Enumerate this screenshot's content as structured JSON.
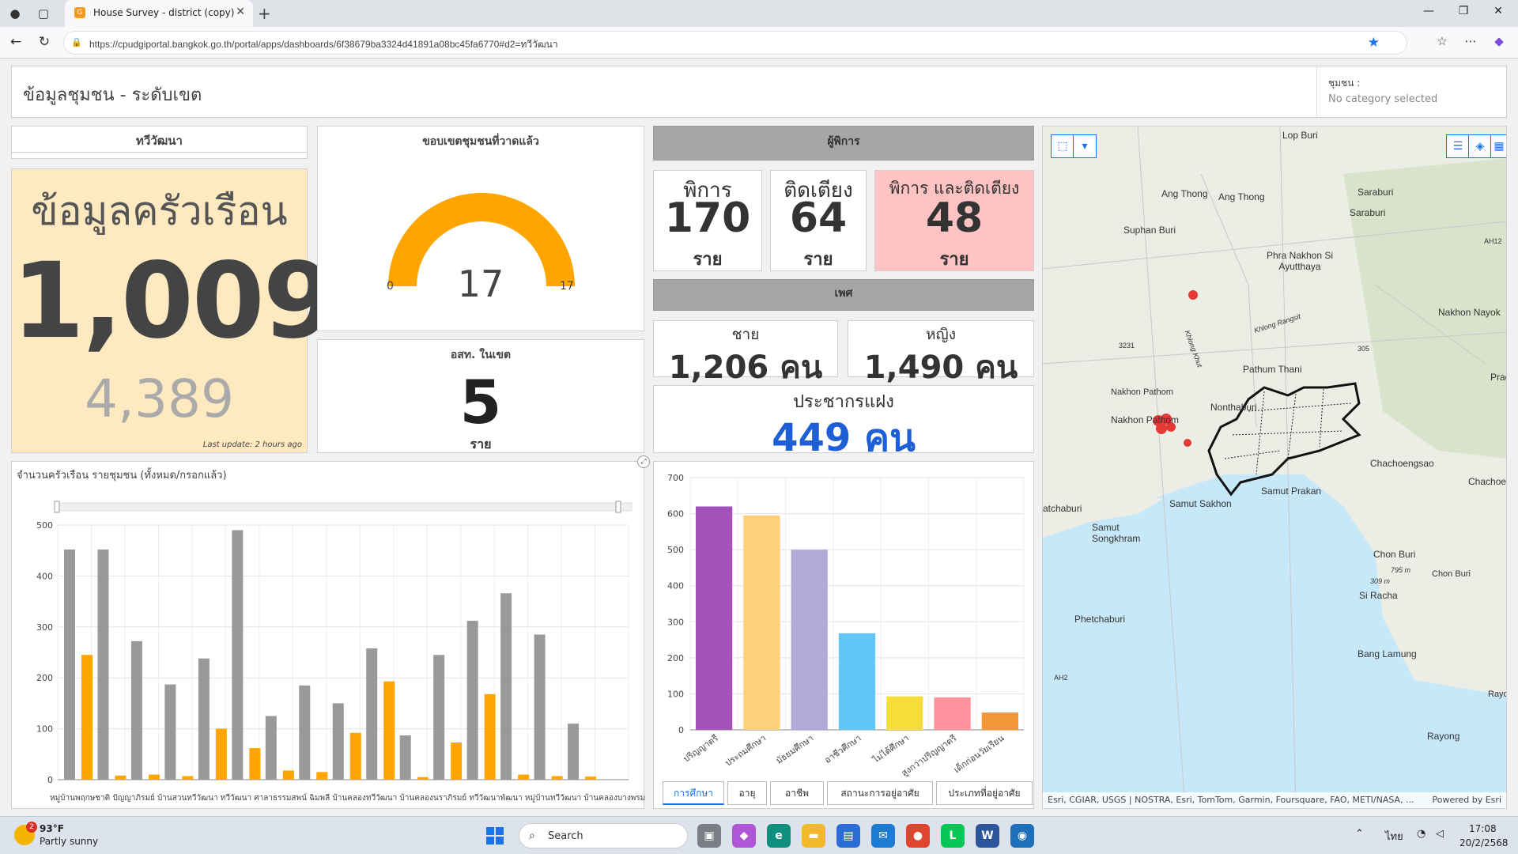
{
  "browser": {
    "tab_title": "House Survey - district (copy)",
    "url": "https://cpudgiportal.bangkok.go.th/portal/apps/dashboards/6f38679ba3324d41891a08bc45fa6770#d2=ทวีวัฒนา"
  },
  "header": {
    "title": "ข้อมูลชุมชน - ระดับเขต",
    "filter_label": "ชุมชน :",
    "filter_value": "No category selected"
  },
  "district": {
    "name": "ทวีวัฒนา"
  },
  "household": {
    "title": "ข้อมูลครัวเรือน",
    "value": "1,009",
    "sub_value": "4,389",
    "last_update": "Last update: 2 hours ago"
  },
  "gauge": {
    "title": "ขอบเขตชุมชนที่วาดแล้ว",
    "value": "17",
    "min": "0",
    "max": "17",
    "fill_fraction": 1.0,
    "color": "#ffa500"
  },
  "osm": {
    "title": "อสท. ในเขต",
    "value": "5",
    "unit": "ราย"
  },
  "disability": {
    "header": "ผู้พิการ",
    "cards": [
      {
        "label": "พิการ",
        "value": "170",
        "unit": "ราย"
      },
      {
        "label": "ติดเตียง",
        "value": "64",
        "unit": "ราย"
      },
      {
        "label": "พิการ และติดเตียง",
        "value": "48",
        "unit": "ราย"
      }
    ]
  },
  "gender": {
    "header": "เพศ",
    "male_label": "ชาย",
    "male_value": "1,206 คน",
    "female_label": "หญิง",
    "female_value": "1,490 คน"
  },
  "hidden_pop": {
    "label": "ประชากรแฝง",
    "value": "449 คน"
  },
  "colors": {
    "header_gray": "#a6a6a6",
    "household_bg": "#ffe9c0",
    "pink_card": "#ffc3c3",
    "accent_blue": "#1e5fd6",
    "bar_gray": "#999999",
    "bar_orange": "#ffa500"
  },
  "chart_data": [
    {
      "type": "bar",
      "title": "จำนวนครัวเรือน รายชุมชน (ทั้งหมด/กรอกแล้ว)",
      "categories": [
        "",
        "",
        "",
        "",
        "",
        "",
        "",
        "",
        "",
        "",
        "",
        "",
        "",
        "",
        "",
        "",
        ""
      ],
      "x_label_text": "หมู่บ้านพฤกษชาติ ปัญญาภิรมย์ บ้านสวนทวีวัฒนา ทวีวัฒนา ศาลาธรรมสพน์ ฉิมพลี บ้านคลองทวีวัฒนา บ้านคลองนราภิรมย์ ทวีวัฒนาพัฒนา หมู่บ้านทวีวัฒนา บ้านคลองบางพรม ทวีวัฒนาประชาร่วมใจ วัดปุรณาวาส หมู่บ้านคลองศาลาธรรมสพน์ บ้านคลองทวีวัฒนา สวนผัก ศาลาธรรมสพน์ สวัสดี",
      "series": [
        {
          "values": [
            452,
            452,
            272,
            187,
            238,
            490,
            125,
            185,
            150,
            258,
            87,
            245,
            312,
            366,
            285,
            110,
            0
          ]
        },
        {
          "values": [
            245,
            8,
            10,
            7,
            100,
            62,
            18,
            15,
            92,
            193,
            5,
            73,
            168,
            10,
            7,
            6,
            0
          ]
        }
      ],
      "y_ticks": [
        "0",
        "100",
        "200",
        "300",
        "400",
        "500"
      ],
      "ylim": [
        0,
        500
      ],
      "grid": true
    },
    {
      "type": "bar",
      "categories": [
        "ปริญญาตรี",
        "ประถมศึกษา",
        "มัธยมศึกษา",
        "อาชีวศึกษา",
        "ไม่ได้ศึกษา",
        "สูงกว่าปริญญาตรี",
        "เด็กก่อนวัยเรียน"
      ],
      "values": [
        620,
        595,
        500,
        268,
        93,
        90,
        48
      ],
      "colors": [
        "#a353b9",
        "#fcd17a",
        "#b3a9d6",
        "#62c6f8",
        "#f7dd3a",
        "#ff929d",
        "#f2983a"
      ],
      "y_ticks": [
        "0",
        "100",
        "200",
        "300",
        "400",
        "500",
        "600",
        "700"
      ],
      "ylim": [
        0,
        700
      ],
      "grid": true,
      "tabs": [
        "การศึกษา",
        "อายุ",
        "อาชีพ",
        "สถานะการอยู่อาศัย",
        "ประเภทที่อยู่อาศัย"
      ],
      "active_tab": "การศึกษา"
    }
  ],
  "map": {
    "labels": [
      "Lop Buri",
      "Ang Thong",
      "Ang Thong",
      "Saraburi",
      "Saraburi",
      "Suphan Buri",
      "Phra Nakhon Si Ayutthaya",
      "Nakhon Nayok",
      "Pathum Thani",
      "Nakhon Pathom",
      "Nakhon Pathom",
      "Nonthaburi",
      "Chachoengsao",
      "Chachoen",
      "Samut Prakan",
      "Samut Sakhon",
      "atchaburi",
      "Samut Songkhram",
      "Chon Buri",
      "Chon Buri",
      "Si Racha",
      "Phetchaburi",
      "Bang Lamung",
      "Rayong",
      "Rayo",
      "Prach",
      "AH2",
      "AH12",
      "3231",
      "305",
      "795 m",
      "309 m",
      "Khlong Rangsit",
      "Khlong Khut"
    ],
    "attribution": "Esri, CGIAR, USGS | NOSTRA, Esri, TomTom, Garmin, Foursquare, FAO, METI/NASA, ...",
    "powered_by": "Powered by Esri",
    "water_color": "#c7e8f8"
  },
  "taskbar": {
    "weather_badge": "2",
    "temperature": "93°F",
    "weather": "Partly sunny",
    "search_placeholder": "Search",
    "language": "ไทย",
    "time": "17:08",
    "date": "20/2/2568"
  }
}
